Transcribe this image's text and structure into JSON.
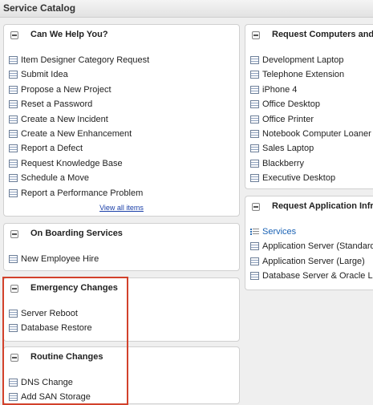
{
  "window": {
    "title": "Service Catalog"
  },
  "panels": {
    "help": {
      "title": "Can We Help You?",
      "items": [
        "Item Designer Category Request",
        "Submit Idea",
        "Propose a New Project",
        "Reset a Password",
        "Create a New Incident",
        "Create a New Enhancement",
        "Report a Defect",
        "Request Knowledge Base",
        "Schedule a Move",
        "Report a Performance Problem"
      ],
      "view_all": "View all items"
    },
    "onboarding": {
      "title": "On Boarding Services",
      "items": [
        "New Employee Hire"
      ]
    },
    "emergency": {
      "title": "Emergency Changes",
      "items": [
        "Server Reboot",
        "Database Restore"
      ]
    },
    "routine": {
      "title": "Routine Changes",
      "items": [
        "DNS Change",
        "Add SAN Storage"
      ]
    },
    "computers": {
      "title": "Request Computers and H",
      "items": [
        "Development Laptop",
        "Telephone Extension",
        "iPhone 4",
        "Office Desktop",
        "Office Printer",
        "Notebook Computer Loaner",
        "Sales Laptop",
        "Blackberry",
        "Executive Desktop"
      ]
    },
    "application": {
      "title": "Request Application Infras",
      "link_item": "Services",
      "items": [
        "Application Server (Standard)",
        "Application Server (Large)",
        "Database Server & Oracle Lic"
      ]
    }
  },
  "colors": {
    "link": "#1a62b4",
    "highlight_border": "#d2412b"
  }
}
